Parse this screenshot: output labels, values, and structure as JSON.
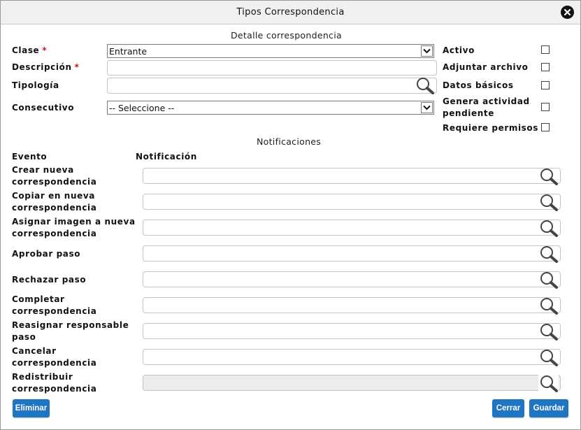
{
  "window": {
    "title": "Tipos Correspondencia"
  },
  "detalle": {
    "section_title": "Detalle correspondencia",
    "clase": {
      "label": "Clase",
      "value": "Entrante"
    },
    "descripcion": {
      "label": "Descripción",
      "value": ""
    },
    "tipologia": {
      "label": "Tipología",
      "value": ""
    },
    "consecutivo": {
      "label": "Consecutivo",
      "value": "-- Seleccione --"
    },
    "required_mark": "*"
  },
  "options": [
    {
      "label": "Activo",
      "checked": false
    },
    {
      "label": "Adjuntar archivo",
      "checked": false
    },
    {
      "label": "Datos básicos",
      "checked": false
    },
    {
      "label": "Genera actividad pendiente",
      "checked": false
    },
    {
      "label": "Requiere permisos",
      "checked": false
    }
  ],
  "notificaciones": {
    "section_title": "Notificaciones",
    "col_evento": "Evento",
    "col_notificacion": "Notificación",
    "rows": [
      {
        "evento": "Crear nueva correspondencia",
        "value": ""
      },
      {
        "evento": "Copiar en nueva correspondencia",
        "value": ""
      },
      {
        "evento": "Asignar imagen a nueva correspondencia",
        "value": ""
      },
      {
        "evento": "Aprobar paso",
        "value": ""
      },
      {
        "evento": "Rechazar paso",
        "value": ""
      },
      {
        "evento": "Completar correspondencia",
        "value": ""
      },
      {
        "evento": "Reasignar responsable paso",
        "value": ""
      },
      {
        "evento": "Cancelar correspondencia",
        "value": ""
      },
      {
        "evento": "Redistribuir correspondencia",
        "value": "",
        "disabled": true
      }
    ]
  },
  "buttons": {
    "eliminar": "Eliminar",
    "cerrar": "Cerrar",
    "guardar": "Guardar"
  },
  "colors": {
    "button_bg": "#1f74c4",
    "required": "#c0151e",
    "titlebar_bg": "#f1f1f1"
  },
  "icons": {
    "lookup": "magnifier-icon",
    "close": "close-circle-icon",
    "dropdown": "chevron-down-icon"
  }
}
